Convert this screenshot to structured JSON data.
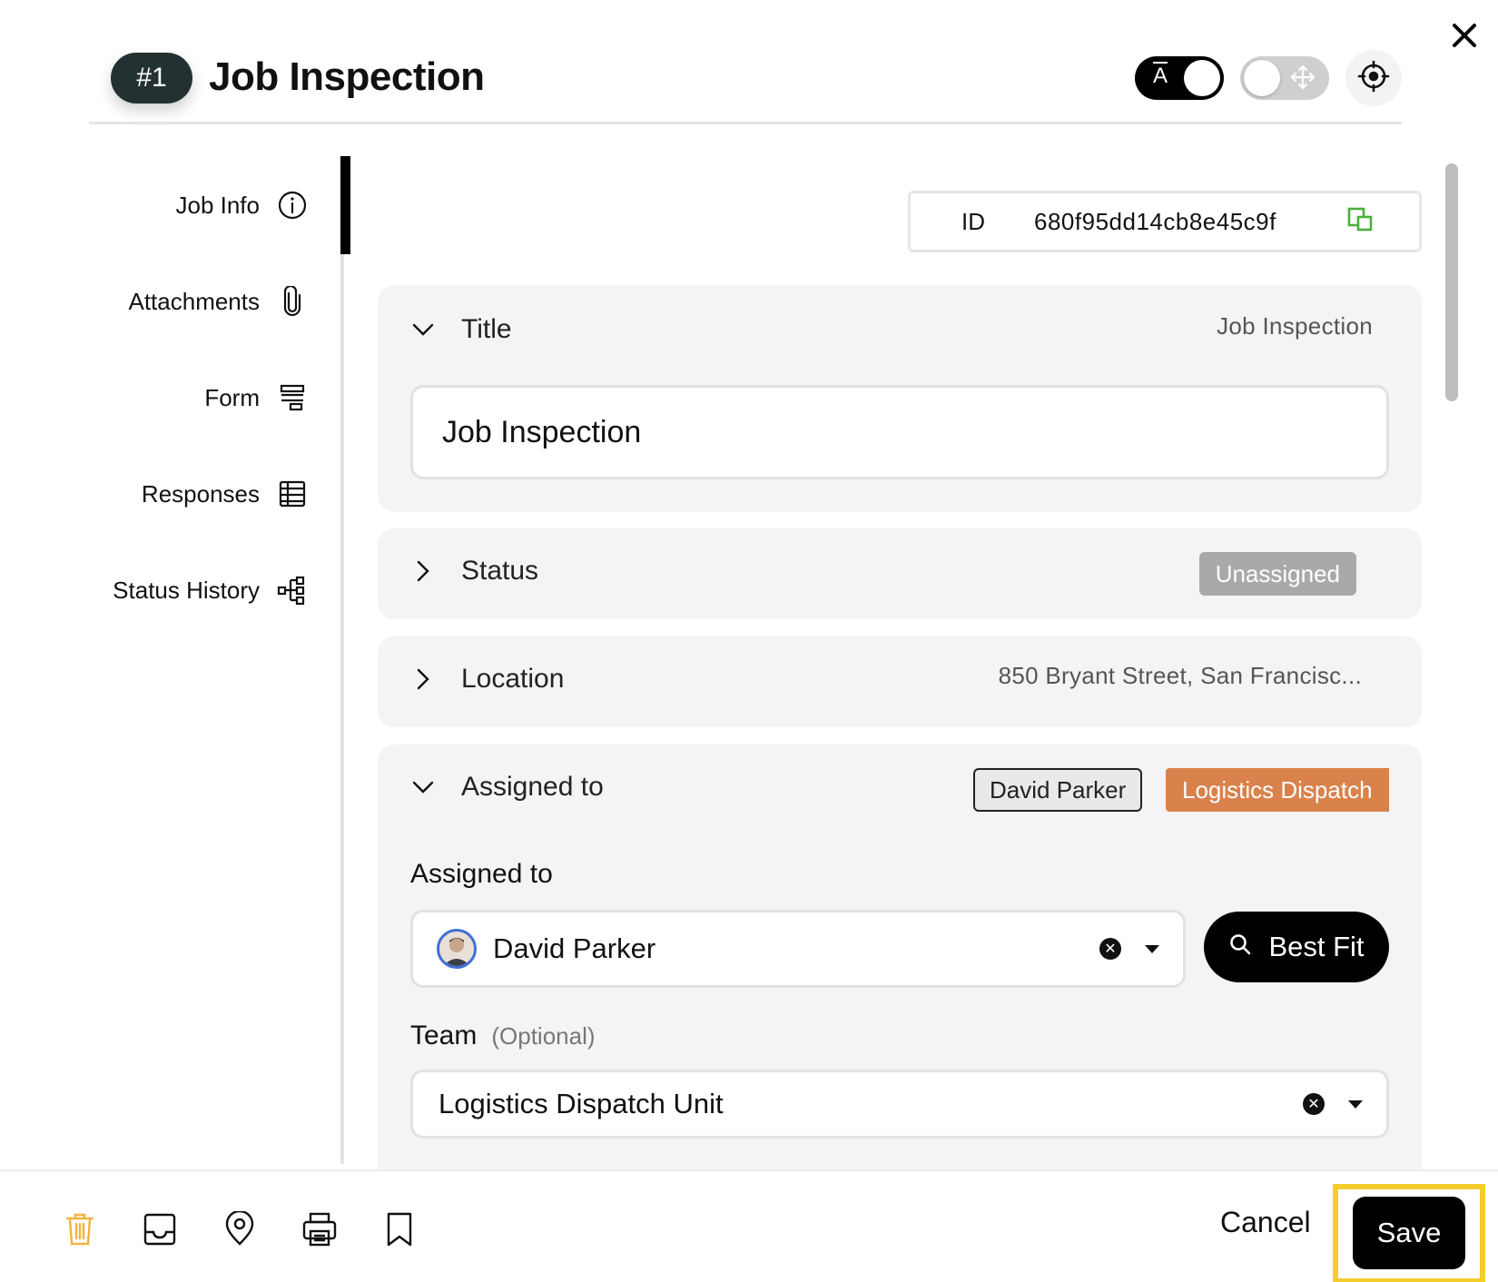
{
  "header": {
    "job_number": "#1",
    "title": "Job Inspection",
    "text_toggle_glyph": "A"
  },
  "sidebar": {
    "items": [
      {
        "label": "Job Info",
        "icon": "info-icon",
        "active": true
      },
      {
        "label": "Attachments",
        "icon": "paperclip-icon",
        "active": false
      },
      {
        "label": "Form",
        "icon": "form-icon",
        "active": false
      },
      {
        "label": "Responses",
        "icon": "table-icon",
        "active": false
      },
      {
        "label": "Status History",
        "icon": "hierarchy-icon",
        "active": false
      }
    ]
  },
  "id_field": {
    "label": "ID",
    "value": "680f95dd14cb8e45c9f"
  },
  "sections": {
    "title": {
      "heading": "Title",
      "summary": "Job Inspection",
      "input_value": "Job Inspection",
      "expanded": true
    },
    "status": {
      "heading": "Status",
      "badge": "Unassigned",
      "expanded": false
    },
    "location": {
      "heading": "Location",
      "summary": "850 Bryant Street, San Francisc...",
      "expanded": false
    },
    "assigned": {
      "heading": "Assigned to",
      "tag_person": "David Parker",
      "tag_team": "Logistics Dispatch",
      "expanded": true,
      "assignee_label": "Assigned to",
      "assignee_value": "David Parker",
      "best_fit_label": "Best Fit",
      "team_label": "Team",
      "team_optional": "(Optional)",
      "team_value": "Logistics Dispatch Unit"
    }
  },
  "footer": {
    "cancel_label": "Cancel",
    "save_label": "Save"
  },
  "colors": {
    "accent_orange": "#d9824b",
    "highlight_yellow": "#f3cd2c",
    "delete_icon": "#f2b33d",
    "copy_icon": "#4caf3c"
  }
}
